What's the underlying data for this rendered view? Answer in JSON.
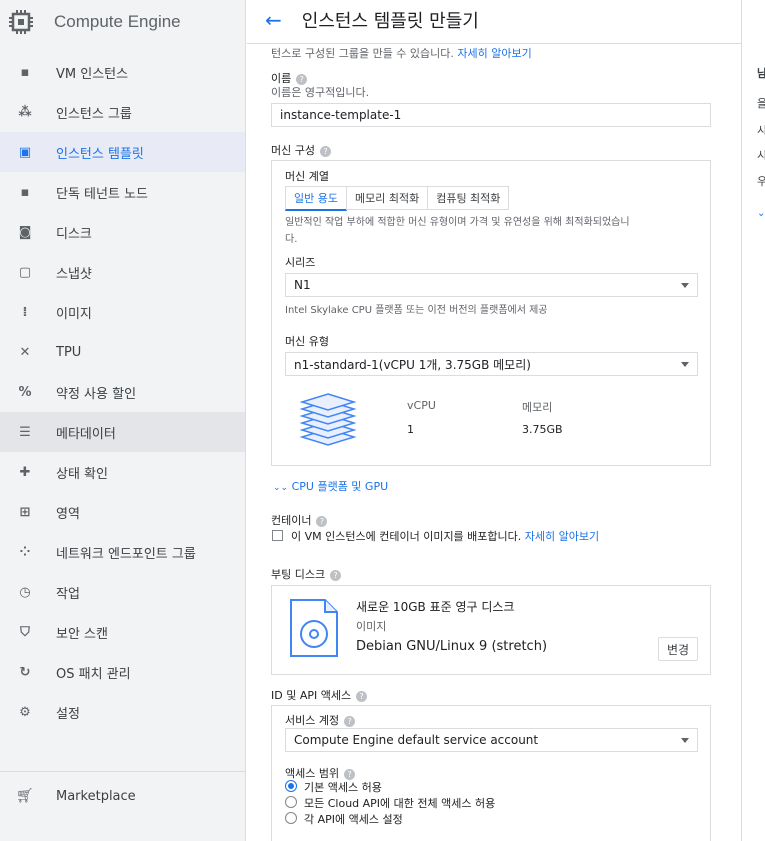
{
  "app": {
    "title": "Compute Engine"
  },
  "sidebar": {
    "items": [
      {
        "label": "VM 인스턴스"
      },
      {
        "label": "인스턴스 그룹"
      },
      {
        "label": "인스턴스 템플릿"
      },
      {
        "label": "단독 테넌트 노드"
      },
      {
        "label": "디스크"
      },
      {
        "label": "스냅샷"
      },
      {
        "label": "이미지"
      },
      {
        "label": "TPU"
      },
      {
        "label": "약정 사용 할인"
      },
      {
        "label": "메타데이터"
      },
      {
        "label": "상태 확인"
      },
      {
        "label": "영역"
      },
      {
        "label": "네트워크 엔드포인트 그룹"
      },
      {
        "label": "작업"
      },
      {
        "label": "보안 스캔"
      },
      {
        "label": "OS 패치 관리"
      },
      {
        "label": "설정"
      }
    ],
    "marketplace": "Marketplace"
  },
  "header": {
    "title": "인스턴스 템플릿 만들기"
  },
  "intro": {
    "text": "턴스로 구성된 그룹을 만들 수 있습니다.",
    "link": "자세히 알아보기"
  },
  "name": {
    "label": "이름",
    "hint": "이름은 영구적입니다.",
    "value": "instance-template-1"
  },
  "machine": {
    "section_label": "머신 구성",
    "family_label": "머신 계열",
    "tabs": [
      "일반 용도",
      "메모리 최적화",
      "컴퓨팅 최적화"
    ],
    "family_desc_line1": "일반적인 작업 부하에 적합한 머신 유형이며 가격 및 유연성을 위해 최적화되었습니",
    "family_desc_line2": "다.",
    "series_label": "시리즈",
    "series_value": "N1",
    "series_desc": "Intel Skylake CPU 플랫폼 또는 이전 버전의 플랫폼에서 제공",
    "type_label": "머신 유형",
    "type_value": "n1-standard-1(vCPU 1개, 3.75GB 메모리)",
    "vcpu_header": "vCPU",
    "memory_header": "메모리",
    "vcpu_value": "1",
    "memory_value": "3.75GB"
  },
  "cpu_platform": {
    "label": "CPU 플랫폼 및 GPU"
  },
  "container": {
    "label": "컨테이너",
    "checkbox_text": "이 VM 인스턴스에 컨테이너 이미지를 배포합니다.",
    "link": "자세히 알아보기"
  },
  "boot_disk": {
    "label": "부팅 디스크",
    "title": "새로운 10GB 표준 영구 디스크",
    "image_label": "이미지",
    "image_value": "Debian GNU/Linux 9 (stretch)",
    "change_button": "변경"
  },
  "identity": {
    "label": "ID 및 API 액세스",
    "service_account_label": "서비스 계정",
    "service_account_value": "Compute Engine default service account",
    "scope_label": "액세스 범위",
    "scope_options": [
      "기본 액세스 허용",
      "모든 Cloud API에 대한 전체 액세스 허용",
      "각 API에 액세스 설정"
    ],
    "scope_selected": 0
  },
  "right_panel": {
    "fragments": [
      "남",
      "을",
      "시",
      "시",
      "우"
    ]
  },
  "colors": {
    "accent": "#1a73e8",
    "sidebar_bg": "#f1f3f4",
    "active_bg": "#e8eaf6",
    "border": "#dadce0"
  }
}
